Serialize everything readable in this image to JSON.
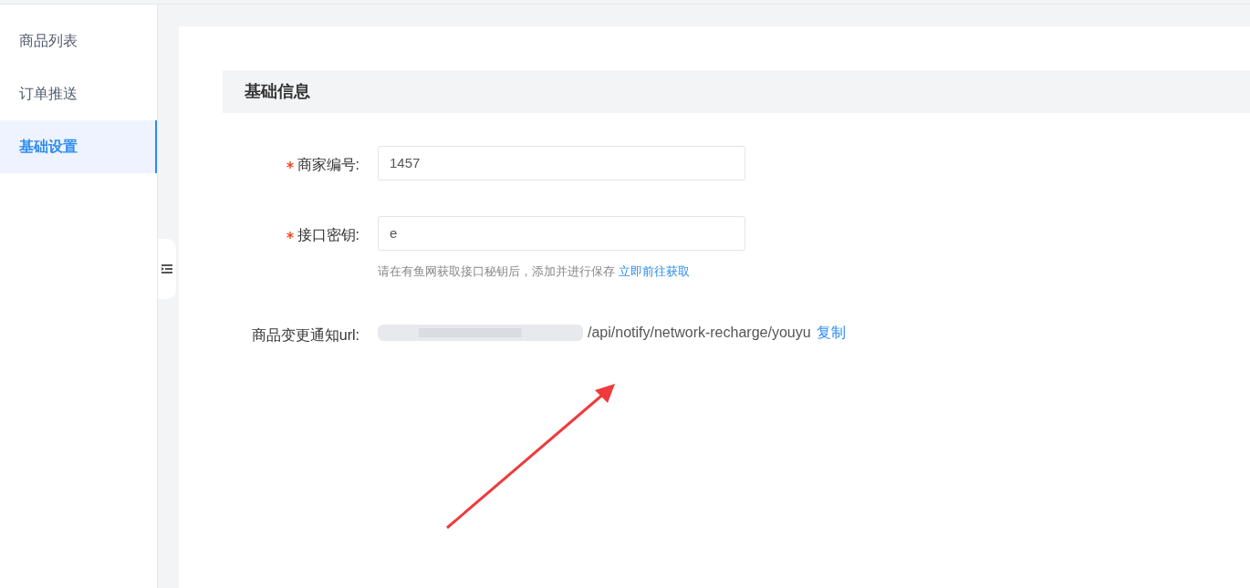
{
  "sidebar": {
    "items": [
      {
        "label": "商品列表",
        "selected": false
      },
      {
        "label": "订单推送",
        "selected": false
      },
      {
        "label": "基础设置",
        "selected": true
      }
    ]
  },
  "section": {
    "title": "基础信息"
  },
  "form": {
    "fields": [
      {
        "kind": "input",
        "label": "商家编号:",
        "required": true,
        "value": "1457"
      },
      {
        "kind": "input",
        "label": "接口密钥:",
        "required": true,
        "value": "e",
        "hint": "请在有鱼网获取接口秘钥后，添加并进行保存",
        "hint_link": "立即前往获取"
      },
      {
        "kind": "text",
        "label": "商品变更通知url:",
        "required": false,
        "value": "/api/notify/network-recharge/youyu",
        "action": "复制"
      }
    ]
  }
}
